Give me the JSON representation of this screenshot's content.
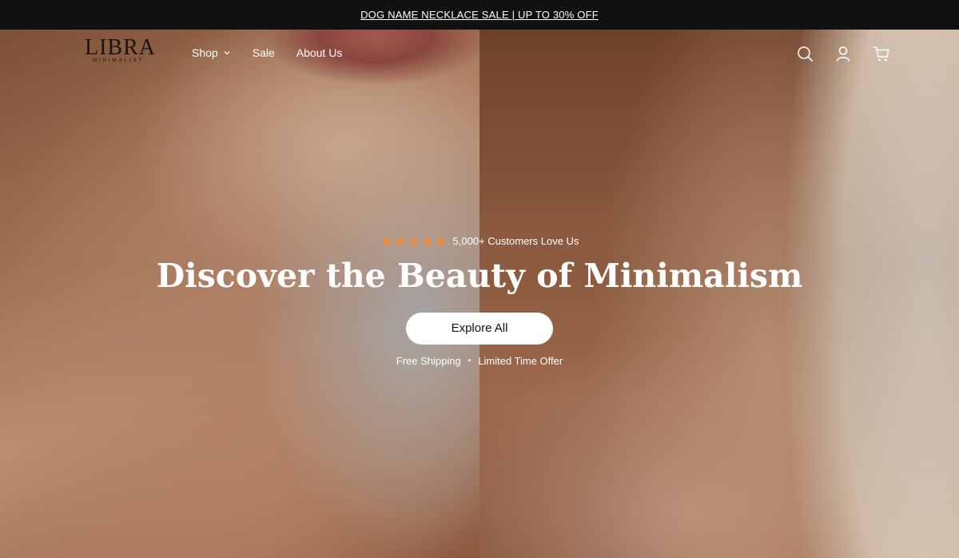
{
  "announcement": {
    "text": "DOG NAME NECKLACE SALE | UP TO 30% OFF"
  },
  "brand": {
    "name": "LIBRA",
    "tagline": "MINIMALIST"
  },
  "nav": {
    "items": [
      {
        "label": "Shop",
        "has_dropdown": true
      },
      {
        "label": "Sale",
        "has_dropdown": false
      },
      {
        "label": "About Us",
        "has_dropdown": false
      }
    ]
  },
  "header_icons": [
    "search-icon",
    "account-icon",
    "cart-icon"
  ],
  "hero": {
    "rating": {
      "stars": 5,
      "text": "5,000+ Customers Love Us"
    },
    "headline": "Discover the Beauty of Minimalism",
    "cta_label": "Explore All",
    "perk_1": "Free Shipping",
    "separator": "•",
    "perk_2": "Limited Time Offer"
  },
  "colors": {
    "announcement_bg": "#111111",
    "star": "#f08a3c",
    "cta_bg": "#ffffff",
    "text_light": "#ffffff"
  }
}
